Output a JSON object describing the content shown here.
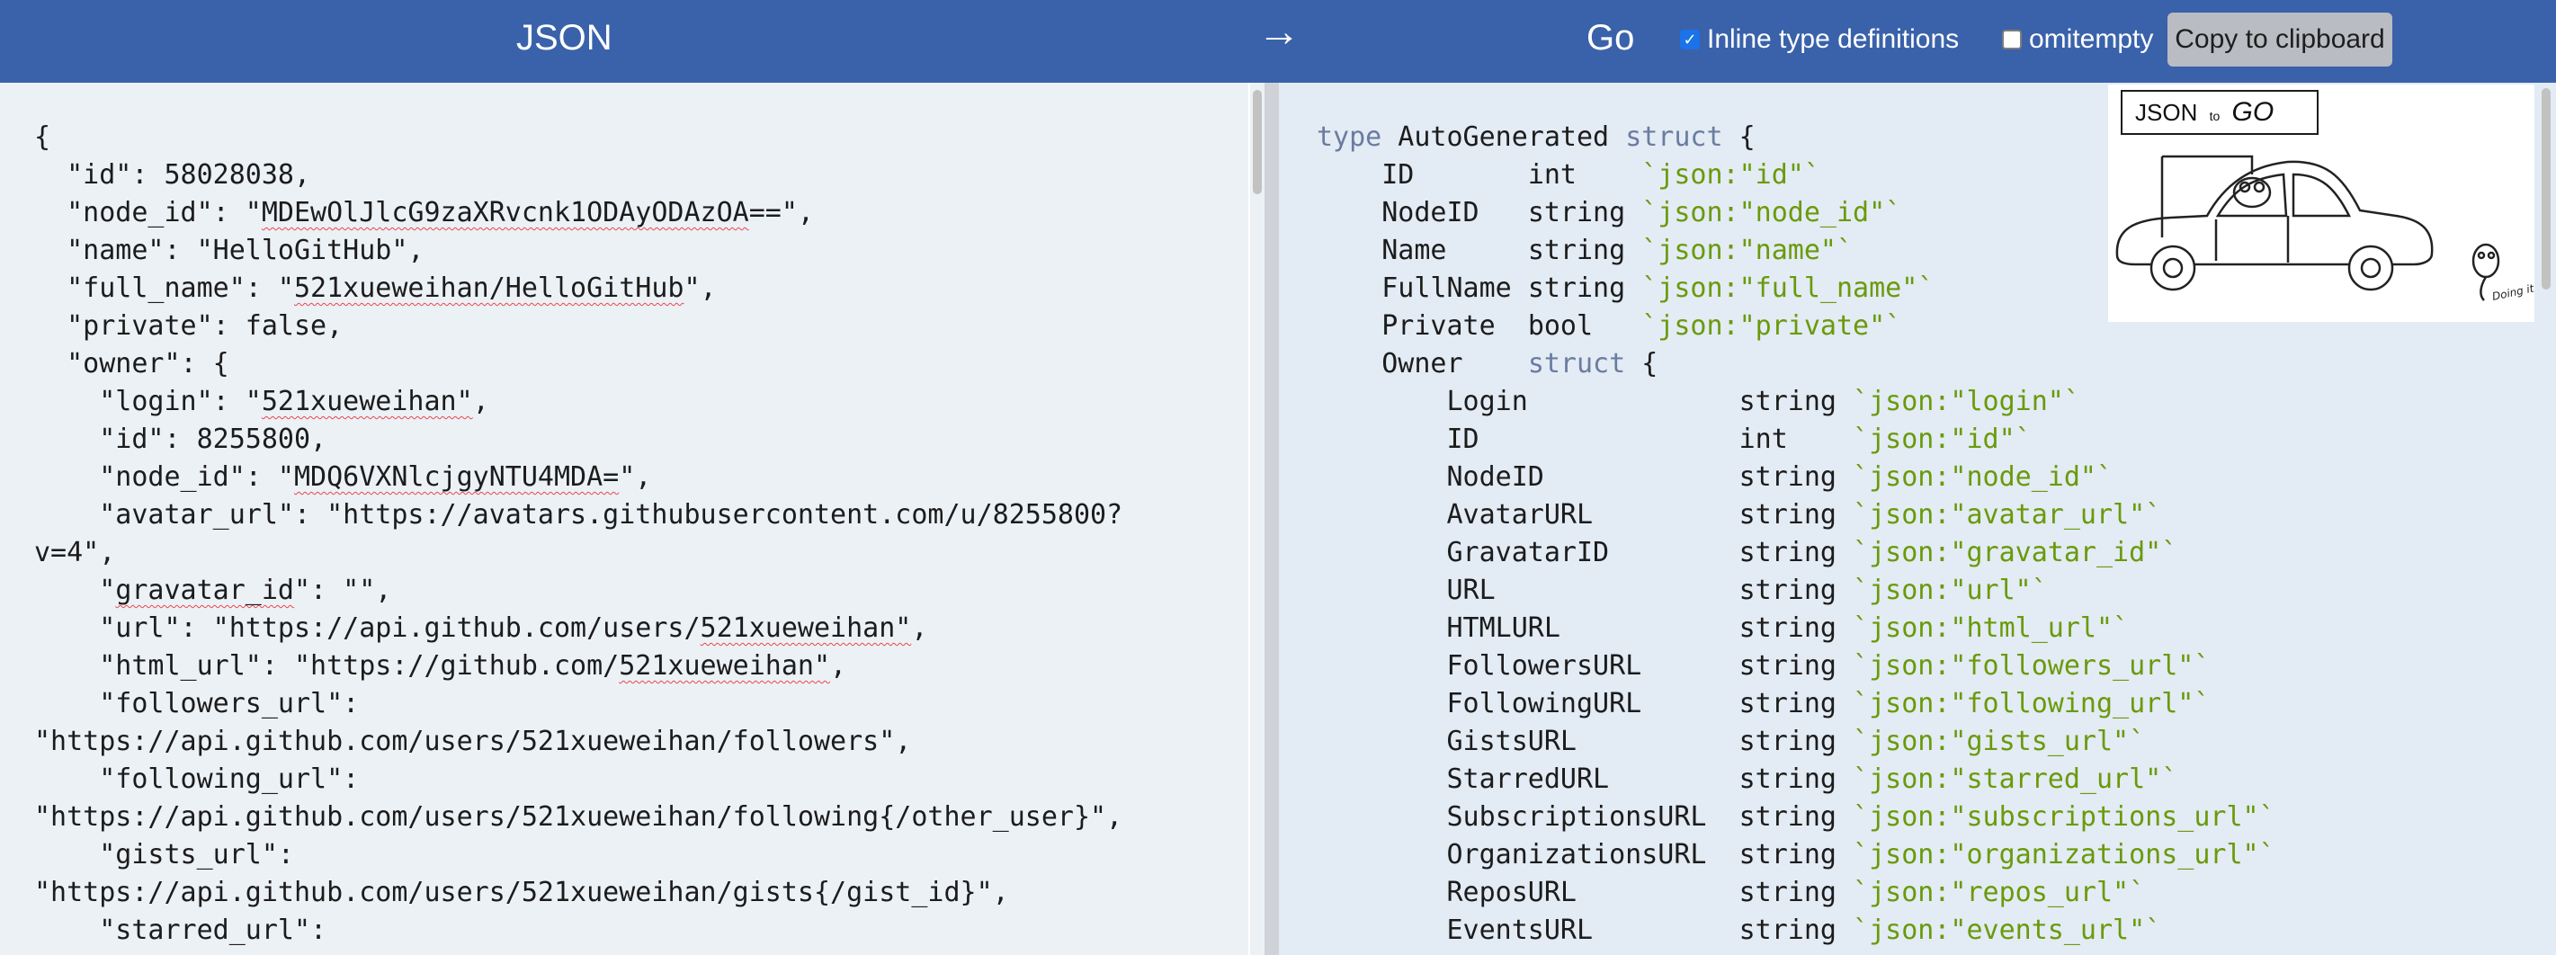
{
  "header": {
    "json_label": "JSON",
    "arrow": "→",
    "go_label": "Go",
    "inline_type_label": "Inline type definitions",
    "inline_type_checked": true,
    "omitempty_label": "omitempty",
    "omitempty_checked": false,
    "copy_button": "Copy to clipboard"
  },
  "logo": {
    "json_text": "JSON",
    "to_text": "to",
    "go_text": "GO",
    "caption": "Doing it by hand"
  },
  "json_input": {
    "lines": [
      "{",
      "  \"id\": 58028038,",
      "  \"node_id\": \"MDEwOlJlcG9zaXRvcnk1ODAyODAzOA==\",",
      "  \"name\": \"HelloGitHub\",",
      "  \"full_name\": \"521xueweihan/HelloGitHub\",",
      "  \"private\": false,",
      "  \"owner\": {",
      "    \"login\": \"521xueweihan\",",
      "    \"id\": 8255800,",
      "    \"node_id\": \"MDQ6VXNlcjgyNTU4MDA=\",",
      "    \"avatar_url\": \"https://avatars.githubusercontent.com/u/8255800?",
      "v=4\",",
      "    \"gravatar_id\": \"\",",
      "    \"url\": \"https://api.github.com/users/521xueweihan\",",
      "    \"html_url\": \"https://github.com/521xueweihan\",",
      "    \"followers_url\":",
      "\"https://api.github.com/users/521xueweihan/followers\",",
      "    \"following_url\":",
      "\"https://api.github.com/users/521xueweihan/following{/other_user}\",",
      "    \"gists_url\":",
      "\"https://api.github.com/users/521xueweihan/gists{/gist_id}\",",
      "    \"starred_url\":"
    ]
  },
  "go_output": {
    "lines": [
      {
        "indent": "",
        "kw1": "type",
        "name": " AutoGenerated ",
        "kw2": "struct",
        "rest": " {"
      },
      {
        "indent": "    ",
        "field": "ID       ",
        "type": "int    ",
        "tag": "`json:\"id\"`"
      },
      {
        "indent": "    ",
        "field": "NodeID   ",
        "type": "string ",
        "tag": "`json:\"node_id\"`"
      },
      {
        "indent": "    ",
        "field": "Name     ",
        "type": "string ",
        "tag": "`json:\"name\"`"
      },
      {
        "indent": "    ",
        "field": "FullName ",
        "type": "string ",
        "tag": "`json:\"full_name\"`"
      },
      {
        "indent": "    ",
        "field": "Private  ",
        "type": "bool   ",
        "tag": "`json:\"private\"`"
      },
      {
        "indent": "    ",
        "field": "Owner    ",
        "kw": "struct",
        "rest": " {"
      },
      {
        "indent": "        ",
        "field": "Login             ",
        "type": "string ",
        "tag": "`json:\"login\"`"
      },
      {
        "indent": "        ",
        "field": "ID                ",
        "type": "int    ",
        "tag": "`json:\"id\"`"
      },
      {
        "indent": "        ",
        "field": "NodeID            ",
        "type": "string ",
        "tag": "`json:\"node_id\"`"
      },
      {
        "indent": "        ",
        "field": "AvatarURL         ",
        "type": "string ",
        "tag": "`json:\"avatar_url\"`"
      },
      {
        "indent": "        ",
        "field": "GravatarID        ",
        "type": "string ",
        "tag": "`json:\"gravatar_id\"`"
      },
      {
        "indent": "        ",
        "field": "URL               ",
        "type": "string ",
        "tag": "`json:\"url\"`"
      },
      {
        "indent": "        ",
        "field": "HTMLURL           ",
        "type": "string ",
        "tag": "`json:\"html_url\"`"
      },
      {
        "indent": "        ",
        "field": "FollowersURL      ",
        "type": "string ",
        "tag": "`json:\"followers_url\"`"
      },
      {
        "indent": "        ",
        "field": "FollowingURL      ",
        "type": "string ",
        "tag": "`json:\"following_url\"`"
      },
      {
        "indent": "        ",
        "field": "GistsURL          ",
        "type": "string ",
        "tag": "`json:\"gists_url\"`"
      },
      {
        "indent": "        ",
        "field": "StarredURL        ",
        "type": "string ",
        "tag": "`json:\"starred_url\"`"
      },
      {
        "indent": "        ",
        "field": "SubscriptionsURL  ",
        "type": "string ",
        "tag": "`json:\"subscriptions_url\"`"
      },
      {
        "indent": "        ",
        "field": "OrganizationsURL  ",
        "type": "string ",
        "tag": "`json:\"organizations_url\"`"
      },
      {
        "indent": "        ",
        "field": "ReposURL          ",
        "type": "string ",
        "tag": "`json:\"repos_url\"`"
      },
      {
        "indent": "        ",
        "field": "EventsURL         ",
        "type": "string ",
        "tag": "`json:\"events_url\"`"
      }
    ]
  },
  "colors": {
    "header_bg": "#3a62aa",
    "left_bg": "#ecf1f6",
    "right_bg": "#e3ebf4",
    "keyword": "#6a7ca0",
    "tag": "#6a9a0a"
  }
}
